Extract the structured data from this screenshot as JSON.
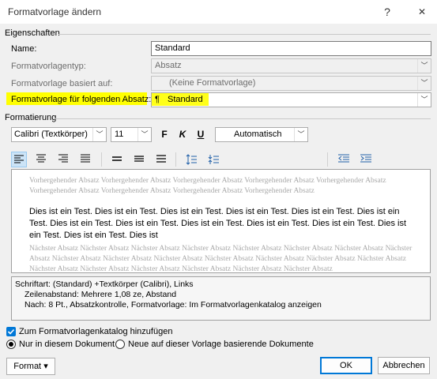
{
  "dialog": {
    "title": "Formatvorlage ändern",
    "help": "?",
    "close": "✕"
  },
  "properties": {
    "section": "Eigenschaften",
    "name_label": "Name:",
    "name_value": "Standard",
    "type_label": "Formatvorlagentyp:",
    "type_value": "Absatz",
    "based_label": "Formatvorlage basiert auf:",
    "based_value": "(Keine Formatvorlage)",
    "next_label": "Formatvorlage für folgenden Absatz:",
    "next_value": "Standard",
    "next_glyph": "¶"
  },
  "formatting": {
    "section": "Formatierung",
    "font": "Calibri (Textkörper)",
    "size": "11",
    "bold": "F",
    "italic": "K",
    "underline": "U",
    "color": "Automatisch"
  },
  "preview": {
    "previous": "Vorhergehender Absatz Vorhergehender Absatz Vorhergehender Absatz Vorhergehender Absatz Vorhergehender Absatz Vorhergehender Absatz Vorhergehender Absatz Vorhergehender Absatz Vorhergehender Absatz",
    "sample": "Dies ist ein Test. Dies ist ein Test. Dies ist ein Test. Dies ist ein Test. Dies ist ein Test. Dies ist ein Test. Dies ist ein Test. Dies ist ein Test. Dies ist ein Test. Dies ist ein Test. Dies ist ein Test. Dies ist ein Test. Dies ist ein Test. Dies ist",
    "next": "Nächster Absatz Nächster Absatz Nächster Absatz Nächster Absatz Nächster Absatz Nächster Absatz Nächster Absatz Nächster Absatz Nächster Absatz Nächster Absatz Nächster Absatz Nächster Absatz Nächster Absatz Nächster Absatz Nächster Absatz Nächster Absatz Nächster Absatz Nächster Absatz Nächster Absatz Nächster Absatz Nächster Absatz"
  },
  "description": {
    "line1": "Schriftart: (Standard) +Textkörper (Calibri), Links",
    "line2": "Zeilenabstand:  Mehrere 1,08 ze, Abstand",
    "line3": "Nach:  8 Pt., Absatzkontrolle, Formatvorlage: Im Formatvorlagenkatalog anzeigen"
  },
  "options": {
    "add_to_gallery": "Zum Formatvorlagenkatalog hinzufügen",
    "only_this_doc": "Nur in diesem Dokument",
    "new_docs": "Neue auf dieser Vorlage basierende Dokumente"
  },
  "buttons": {
    "format": "Format",
    "format_arrow": "▾",
    "ok": "OK",
    "cancel": "Abbrechen"
  },
  "colors": {
    "accent": "#0078d7",
    "highlight": "#ffff00"
  }
}
